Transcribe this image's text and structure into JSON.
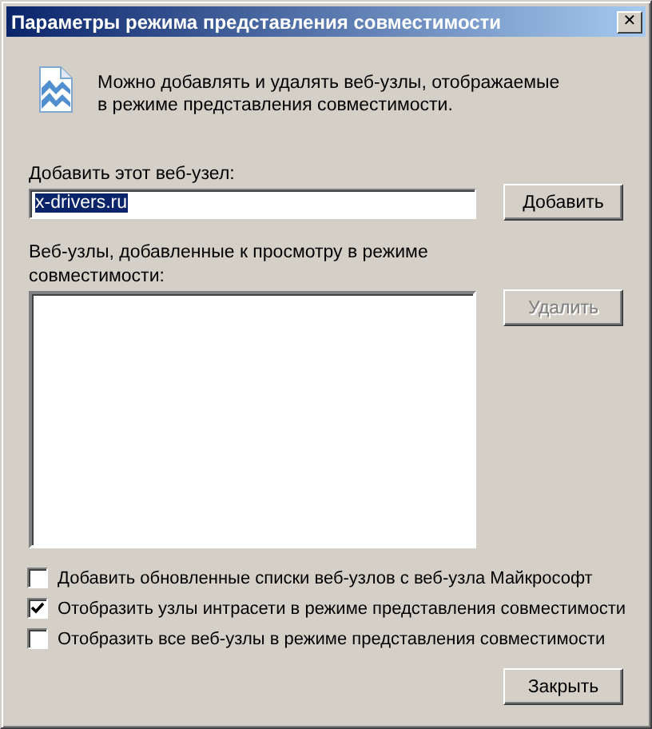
{
  "window": {
    "title": "Параметры режима представления совместимости",
    "close": "✕"
  },
  "intro": "Можно добавлять и удалять веб-узлы, отображаемые в режиме представления совместимости.",
  "add_site": {
    "label": "Добавить этот веб-узел:",
    "value": "x-drivers.ru",
    "text_selected": true,
    "button": {
      "label": "Добавить",
      "disabled": false
    }
  },
  "site_list": {
    "label": "Веб-узлы, добавленные к просмотру в режиме совместимости:",
    "button": {
      "label": "Удалить",
      "disabled": true
    }
  },
  "options": [
    {
      "label": "Добавить обновленные списки веб-узлов с веб-узла Майкрософт",
      "checked": false
    },
    {
      "label": "Отобразить узлы интрасети в режиме представления совместимости",
      "checked": true
    },
    {
      "label": "Отобразить все веб-узлы в режиме представления совместимости",
      "checked": false
    }
  ],
  "buttons": [
    {
      "label": "Закрыть",
      "disabled": false
    }
  ]
}
